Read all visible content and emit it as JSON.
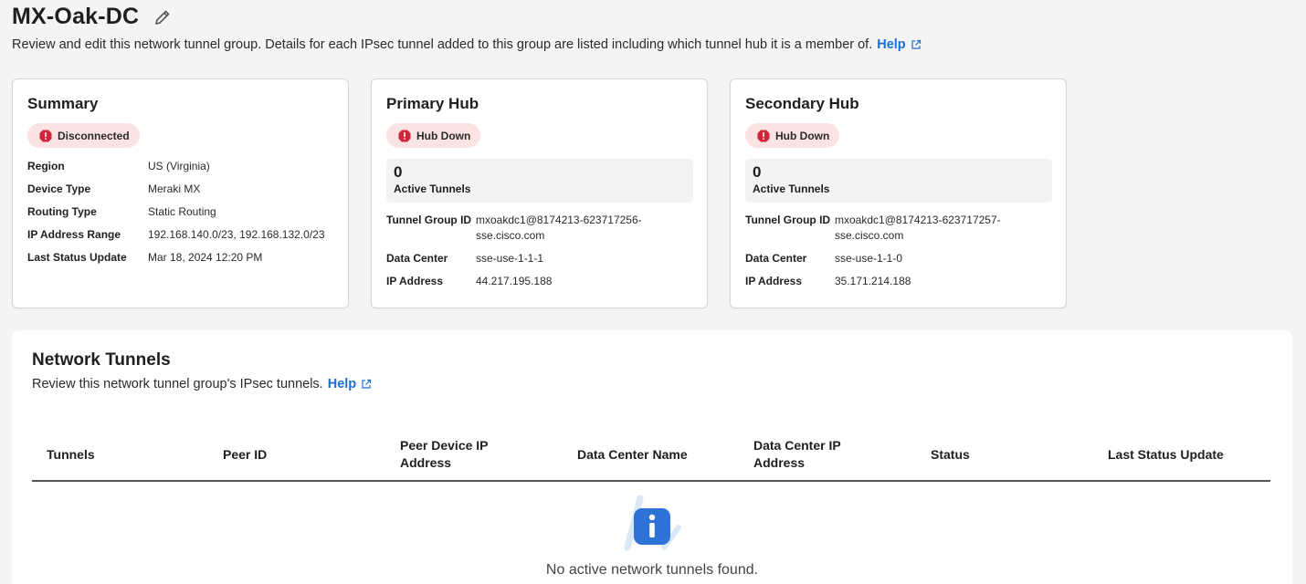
{
  "header": {
    "title": "MX-Oak-DC",
    "subtitle": "Review and edit this network tunnel group. Details for each IPsec tunnel added to this group are listed including which tunnel hub it is a member of.",
    "help_label": "Help"
  },
  "summary": {
    "title": "Summary",
    "status": "Disconnected",
    "fields": [
      {
        "label": "Region",
        "value": "US (Virginia)"
      },
      {
        "label": "Device Type",
        "value": "Meraki MX"
      },
      {
        "label": "Routing Type",
        "value": "Static Routing"
      },
      {
        "label": "IP Address Range",
        "value": "192.168.140.0/23, 192.168.132.0/23"
      },
      {
        "label": "Last Status Update",
        "value": "Mar 18, 2024 12:20 PM"
      }
    ]
  },
  "primary_hub": {
    "title": "Primary Hub",
    "status": "Hub Down",
    "active_tunnels": "0",
    "active_tunnels_label": "Active Tunnels",
    "tunnel_group_id_label": "Tunnel Group ID",
    "tunnel_group_id": "mxoakdc1@8174213-623717256-sse.cisco.com",
    "data_center_label": "Data Center",
    "data_center": "sse-use-1-1-1",
    "ip_address_label": "IP Address",
    "ip_address": "44.217.195.188"
  },
  "secondary_hub": {
    "title": "Secondary Hub",
    "status": "Hub Down",
    "active_tunnels": "0",
    "active_tunnels_label": "Active Tunnels",
    "tunnel_group_id_label": "Tunnel Group ID",
    "tunnel_group_id": "mxoakdc1@8174213-623717257-sse.cisco.com",
    "data_center_label": "Data Center",
    "data_center": "sse-use-1-1-0",
    "ip_address_label": "IP Address",
    "ip_address": "35.171.214.188"
  },
  "network_tunnels": {
    "title": "Network Tunnels",
    "subtitle": "Review this network tunnel group's IPsec tunnels.",
    "help_label": "Help",
    "columns": [
      "Tunnels",
      "Peer ID",
      "Peer Device IP Address",
      "Data Center Name",
      "Data Center IP Address",
      "Status",
      "Last Status Update"
    ],
    "empty_message": "No active network tunnels found."
  },
  "colors": {
    "link": "#1d6fd1",
    "error": "#d1263a",
    "badge_bg": "#fbe3e3",
    "info": "#2d74d6"
  },
  "icons": [
    "edit-icon",
    "external-link-icon",
    "error-icon",
    "info-icon"
  ]
}
